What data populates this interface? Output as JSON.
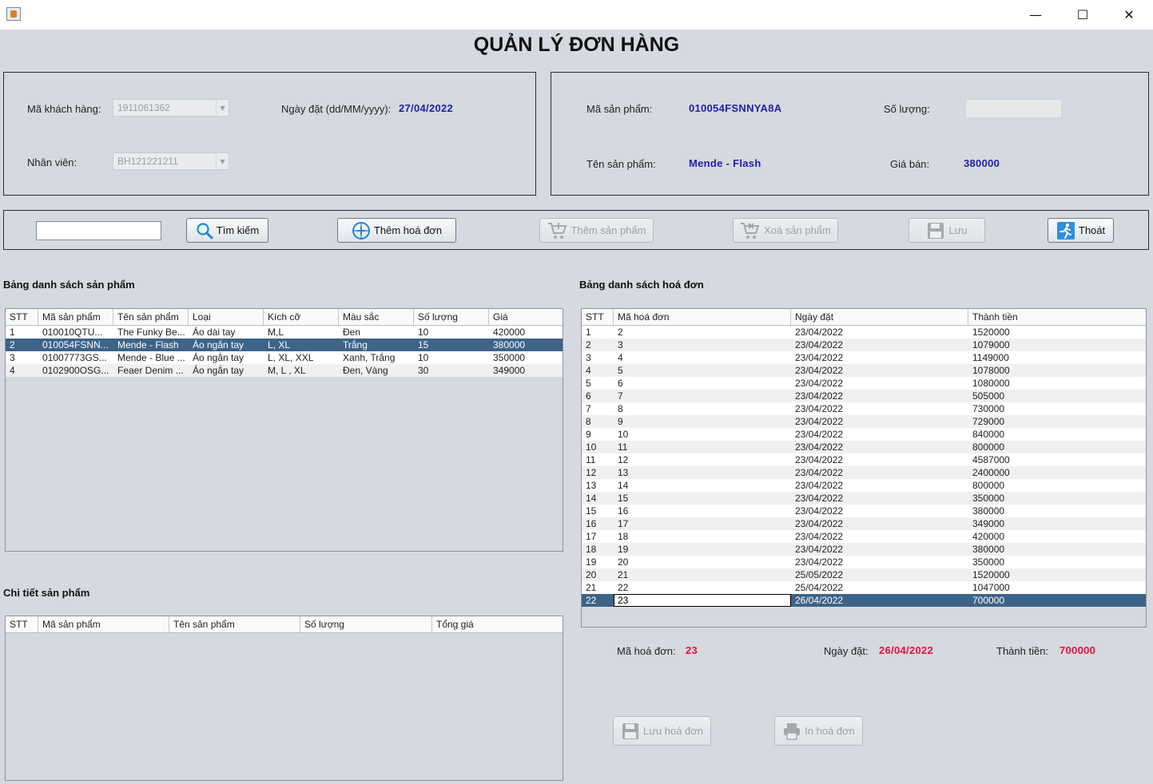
{
  "window": {
    "minimize": "—",
    "maximize": "☐",
    "close": "✕"
  },
  "page_title": "QUẢN LÝ ĐƠN HÀNG",
  "order_info": {
    "customer_label": "Mã khách hàng:",
    "customer_value": "1911061362",
    "employee_label": "Nhân viên:",
    "employee_value": "BH121221211",
    "date_label": "Ngày đặt (dd/MM/yyyy):",
    "date_value": "27/04/2022"
  },
  "product_info": {
    "code_label": "Mã sản phẩm:",
    "code_value": "010054FSNNYA8A",
    "name_label": "Tên sản phẩm:",
    "name_value": "Mende - Flash",
    "qty_label": "Số lượng:",
    "price_label": "Giá bán:",
    "price_value": "380000"
  },
  "toolbar": {
    "search_value": "",
    "search": "Tìm kiếm",
    "add_invoice": "Thêm hoá đơn",
    "add_product": "Thêm sản phẩm",
    "delete_product": "Xoá sản phẩm",
    "save": "Lưu",
    "exit": "Thoát"
  },
  "product_table": {
    "title": "Bảng danh sách sản phẩm",
    "columns": [
      "STT",
      "Mã sản phẩm",
      "Tên sản phẩm",
      "Loại",
      "Kích cỡ",
      "Màu sắc",
      "Số lượng",
      "Giá"
    ],
    "rows": [
      [
        "1",
        "010010QTU...",
        "The Funky Be...",
        "Áo dài tay",
        "M,L",
        "Đen",
        "10",
        "420000"
      ],
      [
        "2",
        "010054FSNN...",
        "Mende - Flash",
        "Áo ngắn tay",
        "L, XL",
        "Trắng",
        "15",
        "380000"
      ],
      [
        "3",
        "01007773GS...",
        "Mende - Blue ...",
        "Áo ngắn tay",
        "L, XL, XXL",
        "Xanh, Trắng",
        "10",
        "350000"
      ],
      [
        "4",
        "0102900OSG...",
        "Feaer Denim ...",
        "Áo ngắn tay",
        "M, L , XL",
        "Đen, Vàng",
        "30",
        "349000"
      ]
    ],
    "selected_row": 1
  },
  "detail_table": {
    "title": "Chi tiết sản phẩm",
    "columns": [
      "STT",
      "Mã sản phẩm",
      "Tên sản phẩm",
      "Số lượng",
      "Tổng giá"
    ]
  },
  "invoice_table": {
    "title": "Bảng danh sách hoá đơn",
    "columns": [
      "STT",
      "Mã hoá đơn",
      "Ngày đặt",
      "Thành tiền"
    ],
    "rows": [
      [
        "1",
        "2",
        "23/04/2022",
        "1520000"
      ],
      [
        "2",
        "3",
        "23/04/2022",
        "1079000"
      ],
      [
        "3",
        "4",
        "23/04/2022",
        "1149000"
      ],
      [
        "4",
        "5",
        "23/04/2022",
        "1078000"
      ],
      [
        "5",
        "6",
        "23/04/2022",
        "1080000"
      ],
      [
        "6",
        "7",
        "23/04/2022",
        "505000"
      ],
      [
        "7",
        "8",
        "23/04/2022",
        "730000"
      ],
      [
        "8",
        "9",
        "23/04/2022",
        "729000"
      ],
      [
        "9",
        "10",
        "23/04/2022",
        "840000"
      ],
      [
        "10",
        "11",
        "23/04/2022",
        "800000"
      ],
      [
        "11",
        "12",
        "23/04/2022",
        "4587000"
      ],
      [
        "12",
        "13",
        "23/04/2022",
        "2400000"
      ],
      [
        "13",
        "14",
        "23/04/2022",
        "800000"
      ],
      [
        "14",
        "15",
        "23/04/2022",
        "350000"
      ],
      [
        "15",
        "16",
        "23/04/2022",
        "380000"
      ],
      [
        "16",
        "17",
        "23/04/2022",
        "349000"
      ],
      [
        "17",
        "18",
        "23/04/2022",
        "420000"
      ],
      [
        "18",
        "19",
        "23/04/2022",
        "380000"
      ],
      [
        "19",
        "20",
        "23/04/2022",
        "350000"
      ],
      [
        "20",
        "21",
        "25/05/2022",
        "1520000"
      ],
      [
        "21",
        "22",
        "25/04/2022",
        "1047000"
      ],
      [
        "22",
        "23",
        "26/04/2022",
        "700000"
      ]
    ],
    "selected_row": 21
  },
  "invoice_summary": {
    "code_label": "Mã hoá đơn:",
    "code_value": "23",
    "date_label": "Ngày đặt:",
    "date_value": "26/04/2022",
    "total_label": "Thành tiền:",
    "total_value": "700000"
  },
  "invoice_actions": {
    "save": "Lưu hoá đơn",
    "print": "In hoá đơn"
  }
}
